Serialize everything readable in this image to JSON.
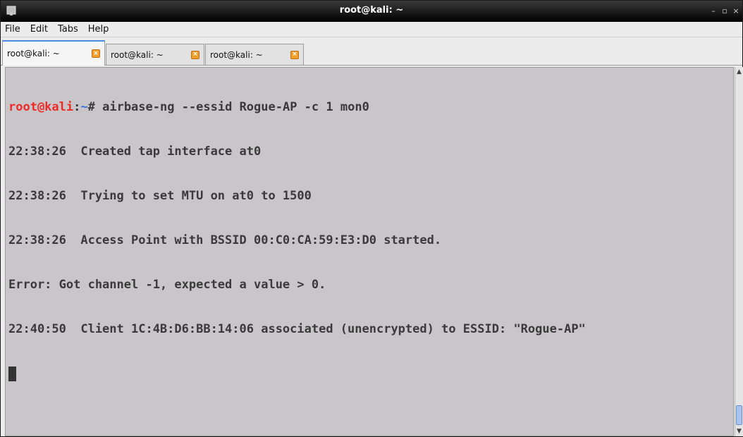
{
  "window": {
    "title": "root@kali: ~",
    "icon": "terminal-icon",
    "controls": {
      "minimize": "–",
      "maximize": "▫",
      "close": "×"
    }
  },
  "menubar": {
    "items": [
      "File",
      "Edit",
      "Tabs",
      "Help"
    ]
  },
  "tabs": [
    {
      "label": "root@kali: ~",
      "active": true,
      "close_icon": "close-icon"
    },
    {
      "label": "root@kali: ~",
      "active": false,
      "close_icon": "close-icon"
    },
    {
      "label": "root@kali: ~",
      "active": false,
      "close_icon": "close-icon"
    }
  ],
  "terminal": {
    "prompt": {
      "user_host": "root@kali",
      "separator": ":",
      "path": "~",
      "symbol": "#"
    },
    "command": " airbase-ng --essid Rogue-AP -c 1 mon0",
    "output_lines": [
      "22:38:26  Created tap interface at0",
      "22:38:26  Trying to set MTU on at0 to 1500",
      "22:38:26  Access Point with BSSID 00:C0:CA:59:E3:D0 started.",
      "Error: Got channel -1, expected a value > 0.",
      "22:40:50  Client 1C:4B:D6:BB:14:06 associated (unencrypted) to ESSID: \"Rogue-AP\""
    ],
    "colors": {
      "background": "#c8c6c8",
      "text": "#3a3a3a",
      "prompt_user": "#ee2a2a",
      "prompt_path": "#3f6fd6"
    }
  }
}
